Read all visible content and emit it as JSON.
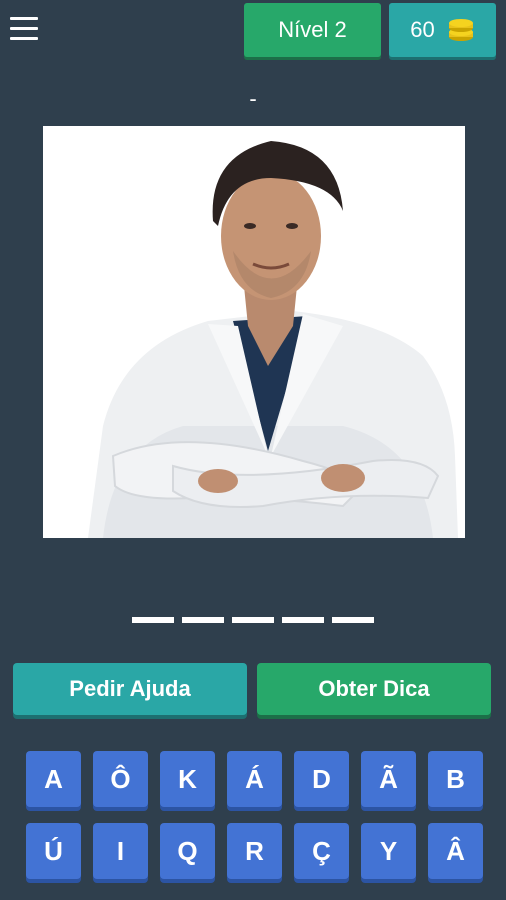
{
  "header": {
    "menu_icon": "hamburger-menu-icon",
    "level_label": "Nível 2",
    "coins": "60",
    "coin_icon": "coin-stack-icon"
  },
  "hint": "-",
  "answer": {
    "slot_count": 5
  },
  "buttons": {
    "help_label": "Pedir Ajuda",
    "tip_label": "Obter Dica"
  },
  "keyboard": {
    "keys": [
      "A",
      "Ô",
      "K",
      "Á",
      "D",
      "Ã",
      "B",
      "Ú",
      "I",
      "Q",
      "R",
      "Ç",
      "Y",
      "Â"
    ]
  },
  "colors": {
    "background": "#2f3f4d",
    "green": "#27a86a",
    "teal": "#2aa7a6",
    "key_blue": "#4373d4"
  }
}
